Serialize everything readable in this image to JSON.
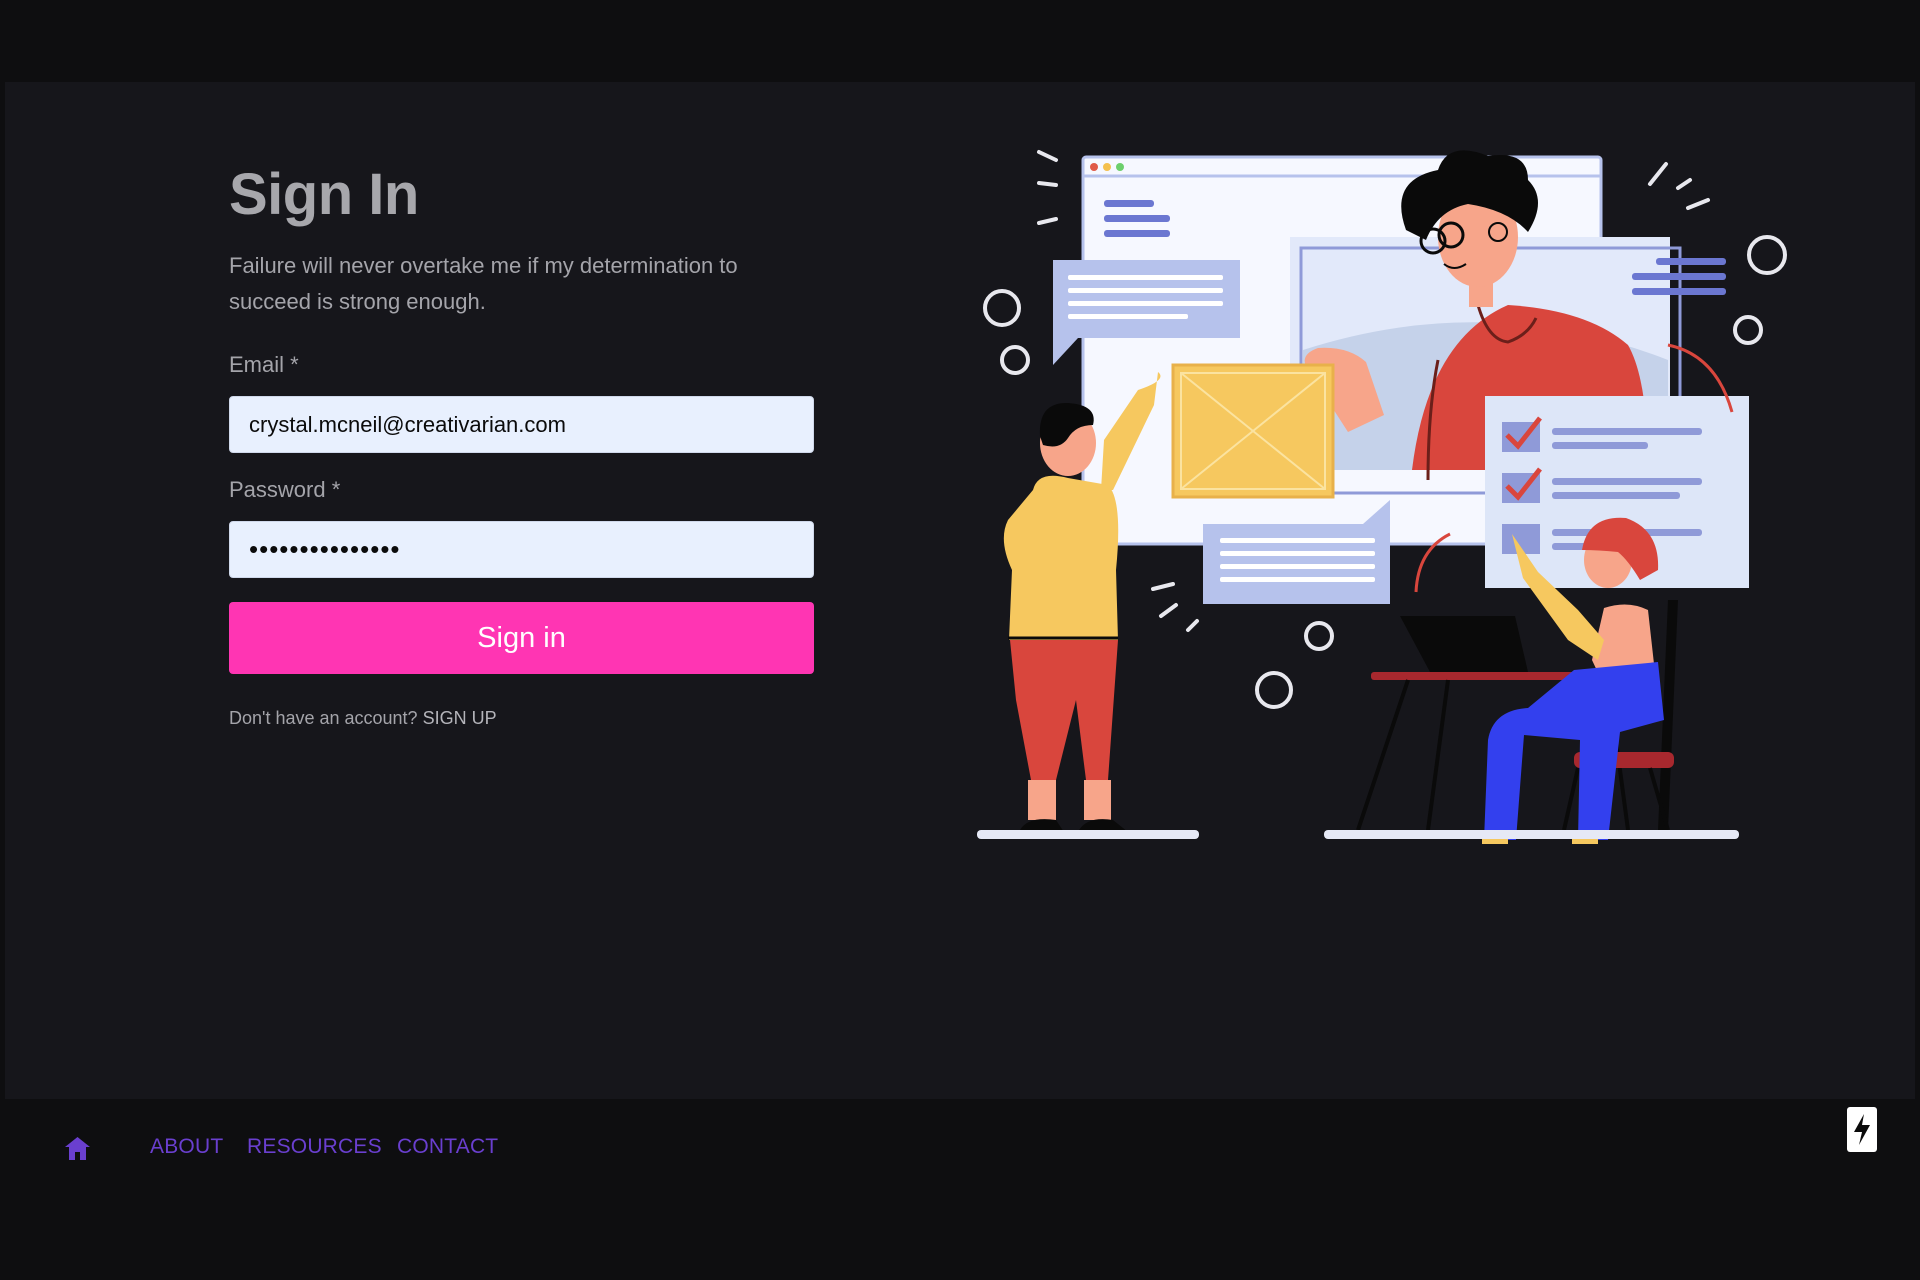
{
  "signin": {
    "title": "Sign In",
    "subtitle": "Failure will never overtake me if my determination to succeed is strong enough.",
    "email_label": "Email *",
    "email_value": "crystal.mcneil@creativarian.com",
    "password_label": "Password *",
    "password_value": "•••••••••••••••",
    "submit_label": "Sign in",
    "signup_prompt": "Don't have an account?",
    "signup_link": "SIGN UP"
  },
  "footer_nav": {
    "home_icon": "home-icon",
    "links": [
      "ABOUT",
      "RESOURCES",
      "CONTACT"
    ]
  },
  "badge": {
    "icon": "lightning-bolt-icon"
  },
  "colors": {
    "page_bg": "#0e0e10",
    "panel_bg": "#16161b",
    "accent_pink": "#ff35b3",
    "nav_purple": "#6a3fcf",
    "input_bg": "#e8f0fe",
    "muted_text": "#a4a4aa"
  }
}
